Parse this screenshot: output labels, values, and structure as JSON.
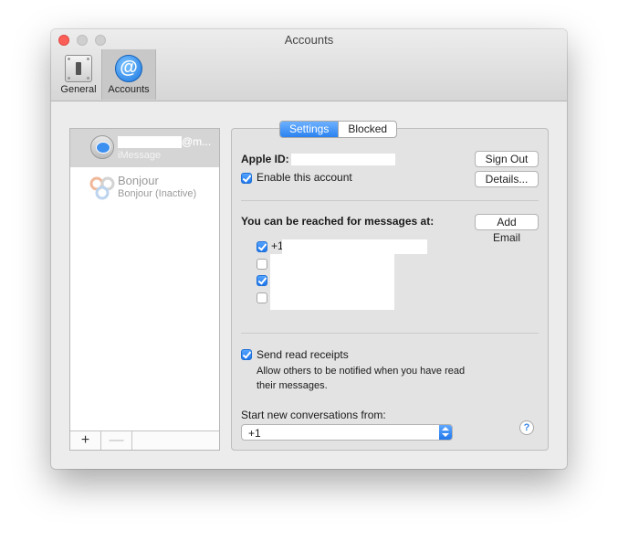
{
  "window": {
    "title": "Accounts"
  },
  "toolbar": {
    "general_label": "General",
    "accounts_label": "Accounts"
  },
  "accounts": [
    {
      "name_suffix": "@m...",
      "service": "iMessage",
      "selected": true
    },
    {
      "name": "Bonjour",
      "service": "Bonjour (Inactive)",
      "selected": false
    }
  ],
  "list_footer": {
    "add": "+",
    "remove": "—"
  },
  "tabs": [
    {
      "label": "Settings",
      "active": true
    },
    {
      "label": "Blocked",
      "active": false
    }
  ],
  "settings": {
    "apple_id_label": "Apple ID:",
    "sign_out": "Sign Out",
    "details": "Details...",
    "enable_account": "Enable this account",
    "reached_label": "You can be reached for messages at:",
    "add_email": "Add Email",
    "addresses": [
      {
        "prefix": "+1",
        "checked": true
      },
      {
        "prefix": "",
        "checked": false
      },
      {
        "prefix": "",
        "checked": true
      },
      {
        "prefix": "",
        "checked": false
      }
    ],
    "send_receipts": "Send read receipts",
    "receipts_desc_1": "Allow others to be notified when you have read",
    "receipts_desc_2": "their messages.",
    "start_from_label": "Start new conversations from:",
    "start_from_value": "+1",
    "help": "?"
  }
}
